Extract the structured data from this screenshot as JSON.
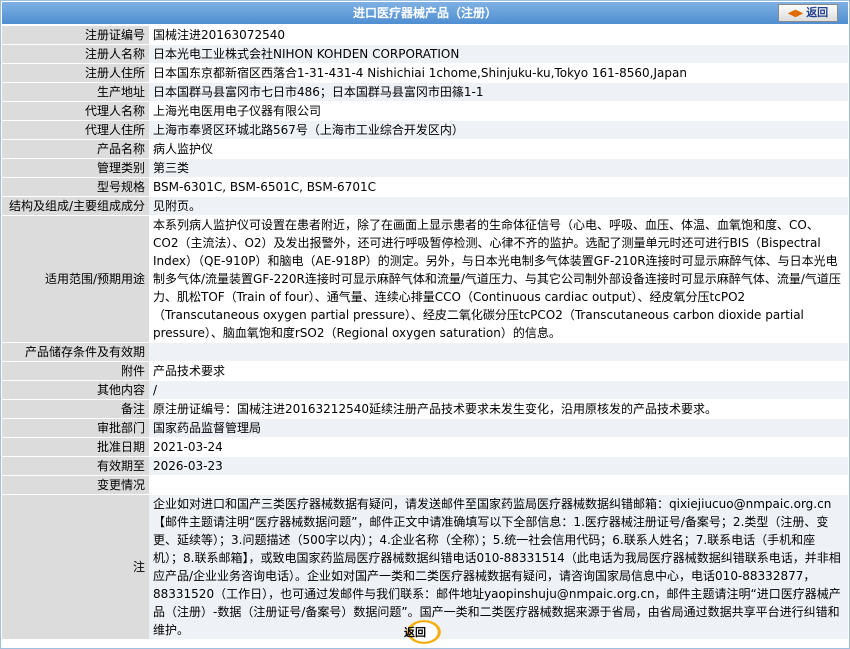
{
  "header": {
    "title": "进口医疗器械产品（注册）",
    "back_label": "返回"
  },
  "rows": [
    {
      "label": "注册证编号",
      "value": "国械注进20163072540"
    },
    {
      "label": "注册人名称",
      "value": "日本光电工业株式会社NIHON KOHDEN CORPORATION"
    },
    {
      "label": "注册人住所",
      "value": "日本国东京都新宿区西落合1-31-431-4 Nishichiai 1chome,Shinjuku-ku,Tokyo 161-8560,Japan"
    },
    {
      "label": "生产地址",
      "value": "日本国群马县富冈市七日市486；日本国群马县富冈市田篠1-1"
    },
    {
      "label": "代理人名称",
      "value": "上海光电医用电子仪器有限公司"
    },
    {
      "label": "代理人住所",
      "value": "上海市奉贤区环城北路567号（上海市工业综合开发区内）"
    },
    {
      "label": "产品名称",
      "value": "病人监护仪"
    },
    {
      "label": "管理类别",
      "value": "第三类"
    },
    {
      "label": "型号规格",
      "value": "BSM-6301C, BSM-6501C, BSM-6701C"
    },
    {
      "label": "结构及组成/主要组成成分",
      "value": "见附页。"
    },
    {
      "label": "适用范围/预期用途",
      "value": "本系列病人监护仪可设置在患者附近，除了在画面上显示患者的生命体征信号（心电、呼吸、血压、体温、血氧饱和度、CO、CO2（主流法）、O2）及发出报警外，还可进行呼吸暂停检测、心律不齐的监护。选配了测量单元时还可进行BIS（Bispectral Index）（QE-910P）和脑电（AE-918P）的测定。另外，与日本光电制多气体装置GF-210R连接时可显示麻醉气体、与日本光电制多气体/流量装置GF-220R连接时可显示麻醉气体和流量/气道压力、与其它公司制外部设备连接时可显示麻醉气体、流量/气道压力、肌松TOF（Train of four）、通气量、连续心排量CCO（Continuous cardiac output）、经皮氧分压tcPO2（Transcutaneous oxygen partial pressure）、经皮二氧化碳分压tcPCO2（Transcutaneous carbon dioxide partial pressure）、脑血氧饱和度rSO2（Regional oxygen saturation）的信息。"
    },
    {
      "label": "产品储存条件及有效期",
      "value": ""
    },
    {
      "label": "附件",
      "value": "产品技术要求"
    },
    {
      "label": "其他内容",
      "value": "/"
    },
    {
      "label": "备注",
      "value": "原注册证编号：国械注进20163212540延续注册产品技术要求未发生变化，沿用原核发的产品技术要求。"
    },
    {
      "label": "审批部门",
      "value": "国家药品监督管理局"
    },
    {
      "label": "批准日期",
      "value": "2021-03-24"
    },
    {
      "label": "有效期至",
      "value": "2026-03-23"
    },
    {
      "label": "变更情况",
      "value": ""
    },
    {
      "label": "注",
      "value": "企业如对进口和国产三类医疗器械数据有疑问，请发送邮件至国家药监局医疗器械数据纠错邮箱：qixiejiucuo@nmpaic.org.cn【邮件主题请注明“医疗器械数据问题”，邮件正文中请准确填写以下全部信息：1.医疗器械注册证号/备案号；2.类型（注册、变更、延续等）；3.问题描述（500字以内）；4.企业名称（全称）；5.统一社会信用代码；6.联系人姓名；7.联系电话（手机和座机）；8.联系邮箱】，或致电国家药监局医疗器械数据纠错电话010-88331514（此电话为我局医疗器械数据纠错联系电话，并非相应产品/企业业务咨询电话）。企业如对国产一类和二类医疗器械数据有疑问，请咨询国家局信息中心，电话010-88332877，88331520（工作日），也可通过发邮件与我们联系：邮件地址yaopinshuju@nmpaic.org.cn，邮件主题请注明“进口医疗器械产品（注册）-数据（注册证号/备案号）数据问题”。国产一类和二类医疗器械数据来源于省局，由省局通过数据共享平台进行纠错和维护。"
    }
  ],
  "footer": {
    "back_label": "返回"
  }
}
